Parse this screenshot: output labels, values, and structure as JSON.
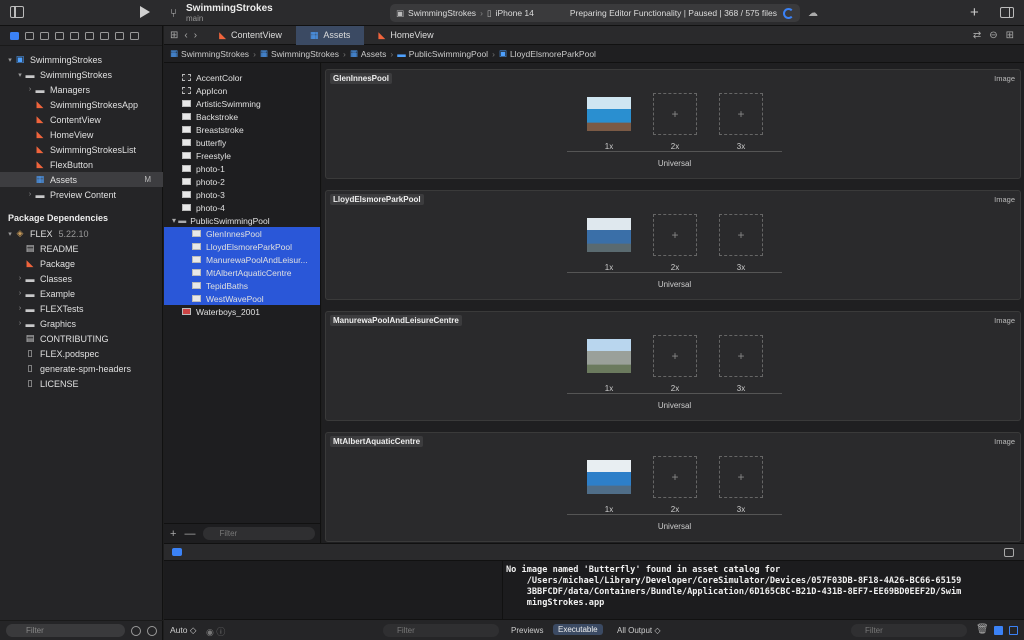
{
  "toolbar": {
    "project_name": "SwimmingStrokes",
    "branch": "main",
    "scheme_target": "SwimmingStrokes",
    "scheme_device": "iPhone 14",
    "status": "Preparing Editor Functionality | Paused | 368 / 575 files"
  },
  "navigator": {
    "project_items": [
      {
        "label": "SwimmingStrokes",
        "icon": "project-icon",
        "level": 0,
        "disc": "▾"
      },
      {
        "label": "SwimmingStrokes",
        "icon": "folder-icon",
        "level": 1,
        "disc": "▾"
      },
      {
        "label": "Managers",
        "icon": "folder-icon",
        "level": 2,
        "disc": "›"
      },
      {
        "label": "SwimmingStrokesApp",
        "icon": "swift-file-icon",
        "level": 2,
        "disc": ""
      },
      {
        "label": "ContentView",
        "icon": "swift-file-icon",
        "level": 2,
        "disc": ""
      },
      {
        "label": "HomeView",
        "icon": "swift-file-icon",
        "level": 2,
        "disc": ""
      },
      {
        "label": "SwimmingStrokesList",
        "icon": "swift-file-icon",
        "level": 2,
        "disc": ""
      },
      {
        "label": "FlexButton",
        "icon": "swift-file-icon",
        "level": 2,
        "disc": ""
      },
      {
        "label": "Assets",
        "icon": "asset-catalog-icon",
        "level": 2,
        "disc": "",
        "selected": true,
        "badge": "M"
      },
      {
        "label": "Preview Content",
        "icon": "folder-icon",
        "level": 2,
        "disc": "›"
      }
    ],
    "package_header": "Package Dependencies",
    "package_name": "FLEX",
    "package_version": "5.22.10",
    "package_items": [
      {
        "label": "README",
        "icon": "book-icon",
        "disc": ""
      },
      {
        "label": "Package",
        "icon": "swift-file-icon",
        "disc": ""
      },
      {
        "label": "Classes",
        "icon": "folder-icon",
        "disc": "›"
      },
      {
        "label": "Example",
        "icon": "folder-icon",
        "disc": "›"
      },
      {
        "label": "FLEXTests",
        "icon": "folder-icon",
        "disc": "›"
      },
      {
        "label": "Graphics",
        "icon": "folder-icon",
        "disc": "›"
      },
      {
        "label": "CONTRIBUTING",
        "icon": "book-icon",
        "disc": ""
      },
      {
        "label": "FLEX.podspec",
        "icon": "doc-icon",
        "disc": ""
      },
      {
        "label": "generate-spm-headers",
        "icon": "doc-icon",
        "disc": ""
      },
      {
        "label": "LICENSE",
        "icon": "doc-icon",
        "disc": ""
      }
    ],
    "filter_placeholder": "Filter"
  },
  "tabs": [
    {
      "label": "ContentView",
      "kind": "swift"
    },
    {
      "label": "Assets",
      "kind": "asset",
      "active": true
    },
    {
      "label": "HomeView",
      "kind": "swift"
    }
  ],
  "breadcrumb": [
    "SwimmingStrokes",
    "SwimmingStrokes",
    "Assets",
    "PublicSwimmingPool",
    "LloydElsmoreParkPool"
  ],
  "asset_list": {
    "items": [
      {
        "label": "AccentColor",
        "thumb": "dash"
      },
      {
        "label": "AppIcon",
        "thumb": "dash"
      },
      {
        "label": "ArtisticSwimming",
        "thumb": "img"
      },
      {
        "label": "Backstroke",
        "thumb": "img"
      },
      {
        "label": "Breaststroke",
        "thumb": "img"
      },
      {
        "label": "butterfly",
        "thumb": "img"
      },
      {
        "label": "Freestyle",
        "thumb": "img"
      },
      {
        "label": "photo-1",
        "thumb": "img"
      },
      {
        "label": "photo-2",
        "thumb": "img"
      },
      {
        "label": "photo-3",
        "thumb": "img"
      },
      {
        "label": "photo-4",
        "thumb": "img"
      }
    ],
    "group": "PublicSwimmingPool",
    "group_items": [
      "GlenInnesPool",
      "LloydElsmoreParkPool",
      "ManurewaPoolAndLeisur...",
      "MtAlbertAquaticCentre",
      "TepidBaths",
      "WestWavePool"
    ],
    "after_group": "Waterboys_2001",
    "filter_placeholder": "Filter"
  },
  "image_sets": [
    {
      "name": "GlenInnesPool",
      "type": "Image",
      "colors": [
        "#cfe6f2",
        "#2a8fd0",
        "#7b5a45"
      ]
    },
    {
      "name": "LloydElsmoreParkPool",
      "type": "Image",
      "colors": [
        "#dfe8ee",
        "#3a6fa8",
        "#5a6a70"
      ]
    },
    {
      "name": "ManurewaPoolAndLeisureCentre",
      "type": "Image",
      "colors": [
        "#b9d6ee",
        "#9aa09a",
        "#6b7a5e"
      ]
    },
    {
      "name": "MtAlbertAquaticCentre",
      "type": "Image",
      "colors": [
        "#e8eef2",
        "#2d7fc9",
        "#4f6d88"
      ]
    }
  ],
  "slot_labels": [
    "1x",
    "2x",
    "3x"
  ],
  "universal_label": "Universal",
  "console_text": "No image named 'Butterfly' found in asset catalog for\n    /Users/michael/Library/Developer/CoreSimulator/Devices/057F03DB-8F18-4A26-BC66-65159\n    3BBFCDF/data/Containers/Bundle/Application/6D165CBC-B21D-431B-8EF7-EE69BD0EEF2D/Swim\n    mingStrokes.app",
  "debug_footer": {
    "auto": "Auto ◇",
    "filter": "Filter",
    "previews": "Previews",
    "executable": "Executable",
    "all_output": "All Output ◇",
    "filter2": "Filter"
  }
}
